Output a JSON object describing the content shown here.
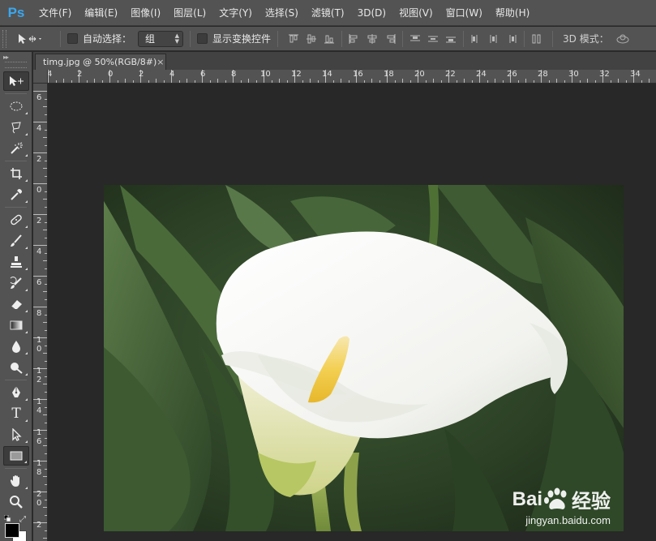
{
  "app": {
    "logo": "Ps"
  },
  "menu": [
    "文件(F)",
    "编辑(E)",
    "图像(I)",
    "图层(L)",
    "文字(Y)",
    "选择(S)",
    "滤镜(T)",
    "3D(D)",
    "视图(V)",
    "窗口(W)",
    "帮助(H)"
  ],
  "options": {
    "auto_select_label": "自动选择：",
    "auto_select_value": "组",
    "show_transform_label": "显示变换控件",
    "mode3d_label": "3D 模式：",
    "auto_select_checked": false,
    "show_transform_checked": false
  },
  "document": {
    "tab_title": "timg.jpg @ 50%(RGB/8#)",
    "close_glyph": "×"
  },
  "ruler": {
    "top_labels": [
      "4",
      "2",
      "0",
      "2",
      "4",
      "6",
      "8",
      "10",
      "12",
      "14",
      "16",
      "18",
      "20",
      "22",
      "24",
      "26",
      "28",
      "30",
      "32",
      "34"
    ],
    "left_labels": [
      "6",
      "4",
      "2",
      "0",
      "2",
      "4",
      "6",
      "8",
      "1 0",
      "1 2",
      "1 4",
      "1 6",
      "1 8",
      "2 0",
      "2"
    ]
  },
  "toolbar": {
    "tools": [
      "move-tool",
      "elliptical-marquee-tool",
      "lasso-tool",
      "magic-wand-tool",
      "crop-tool",
      "eyedropper-tool",
      "healing-brush-tool",
      "brush-tool",
      "clone-stamp-tool",
      "history-brush-tool",
      "eraser-tool",
      "gradient-tool",
      "blur-tool",
      "dodge-tool",
      "pen-tool",
      "type-tool",
      "path-selection-tool",
      "rectangle-tool",
      "hand-tool",
      "zoom-tool"
    ],
    "type_glyph": "T",
    "foreground_color": "#000000",
    "background_color": "#ffffff"
  },
  "watermark": {
    "brand_left": "Bai",
    "brand_right": "经验",
    "url": "jingyan.baidu.com"
  },
  "colors": {
    "ps_blue": "#3aa7f0",
    "chrome": "#535353",
    "canvas_bg": "#282828"
  }
}
